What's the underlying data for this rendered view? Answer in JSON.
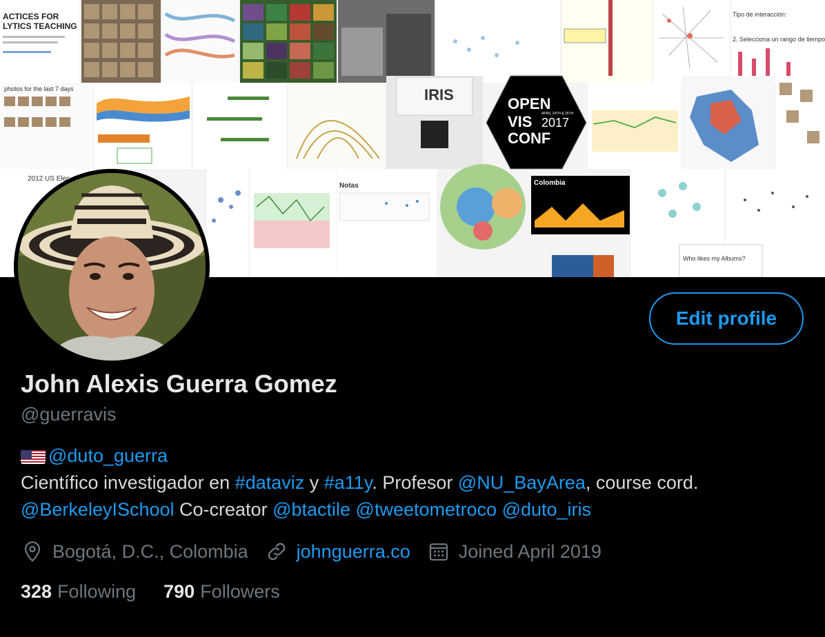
{
  "profile": {
    "name": "John Alexis Guerra Gomez",
    "handle": "@guerravis",
    "edit_button": "Edit profile"
  },
  "bio": {
    "line1_mention": "@duto_guerra",
    "text_a": "Científico investigador en ",
    "tag_dataviz": "#dataviz",
    "text_b": " y ",
    "tag_a11y": "#a11y",
    "text_c": ". Profesor ",
    "mention_nu": "@NU_BayArea",
    "text_d": ", course cord.",
    "mention_berkeley": "@BerkeleyISchool",
    "text_e": " Co-creator ",
    "mention_btactile": "@btactile",
    "mention_tweetometro": "@tweetometroco",
    "mention_iris": "@duto_iris"
  },
  "meta": {
    "location": "Bogotá, D.C., Colombia",
    "website": "johnguerra.co",
    "joined": "Joined April 2019"
  },
  "stats": {
    "following_count": "328",
    "following_label": "Following",
    "followers_count": "790",
    "followers_label": "Followers"
  },
  "banner_text": {
    "practices_line1": "ACTICES FOR",
    "practices_line2": "LYTICS TEACHING",
    "openvis_line1": "OPEN",
    "openvis_line2": "VIS",
    "openvis_year": "2017",
    "openvis_line3": "CONF",
    "openvis_date": "APRIL 24TH & 25TH",
    "iris_label": "IRIS",
    "colombia_label": "Colombia",
    "photos_label": "photos for the last 7 days",
    "us_label": "2012 US Elec",
    "notas_label": "Notas",
    "tipo_label": "Tipo de interacción:",
    "rango_label": "2. Selecciona un rango de tiempo",
    "who_label": "Who likes my Albums?"
  },
  "colors": {
    "accent": "#1d9bf0",
    "secondary_text": "#6e767d",
    "primary_text": "#e7e7e7"
  }
}
